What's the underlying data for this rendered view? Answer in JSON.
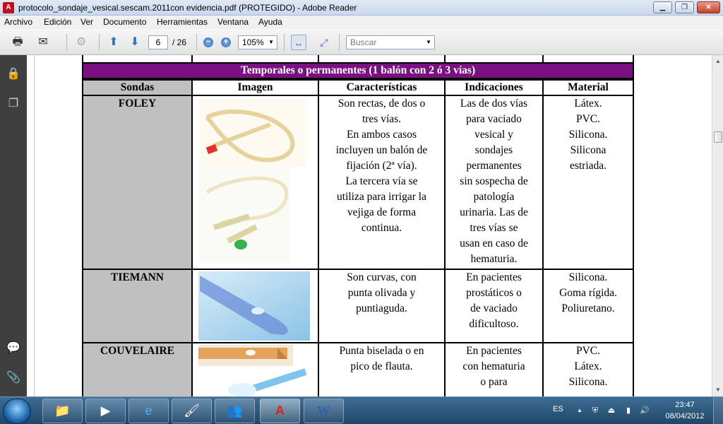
{
  "window": {
    "title": "protocolo_sondaje_vesical.sescam.2011con evidencia.pdf (PROTEGIDO) - Adobe Reader",
    "min_label": "▁",
    "max_label": "❐",
    "close_label": "✕"
  },
  "menu": [
    "Archivo",
    "Edición",
    "Ver",
    "Documento",
    "Herramientas",
    "Ventana",
    "Ayuda"
  ],
  "toolbar": {
    "page_current": "6",
    "page_total": "/ 26",
    "zoom": "105%",
    "search_placeholder": "Buscar",
    "zoom_out_label": "−",
    "zoom_in_label": "+"
  },
  "table": {
    "banner": "Temporales o permanentes (1 balón con 2 ó 3 vías)",
    "headers": [
      "Sondas",
      "Imagen",
      "Características",
      "Indicaciones",
      "Material"
    ],
    "rows": [
      {
        "name": "FOLEY",
        "caracteristicas": [
          "Son rectas, de dos o",
          "tres vías.",
          "En ambos casos",
          "incluyen un balón de",
          "fijación (2ª vía).",
          "La tercera vía se",
          "utiliza para irrigar la",
          "vejiga de forma",
          "continua."
        ],
        "indicaciones": [
          "Las de dos vías",
          "para vaciado",
          "vesical y",
          "sondajes",
          "permanentes",
          "sin sospecha de",
          "patología",
          "urinaria. Las de",
          "tres vías se",
          "usan en caso de",
          "hematuria."
        ],
        "material": [
          "Látex.",
          "PVC.",
          "Silicona.",
          "Silicona",
          "estriada."
        ]
      },
      {
        "name": "TIEMANN",
        "caracteristicas": [
          "Son curvas, con",
          "punta olivada y",
          "puntiaguda."
        ],
        "indicaciones": [
          "En pacientes",
          "prostáticos o",
          "de vaciado",
          "dificultoso."
        ],
        "material": [
          "Silicona.",
          "Goma rígida.",
          "Poliuretano."
        ]
      },
      {
        "name": "COUVELAIRE",
        "caracteristicas": [
          "Punta biselada o en",
          "pico de flauta."
        ],
        "indicaciones": [
          "En pacientes",
          "con hematuria",
          "o para"
        ],
        "material": [
          "PVC.",
          "Látex.",
          "Silicona."
        ]
      }
    ]
  },
  "taskbar": {
    "lang": "ES",
    "time": "23:47",
    "date": "08/04/2012"
  },
  "colors": {
    "banner": "#7a1180",
    "grey_cell": "#c0c0c0",
    "nav_panel": "#3f3f3f"
  }
}
